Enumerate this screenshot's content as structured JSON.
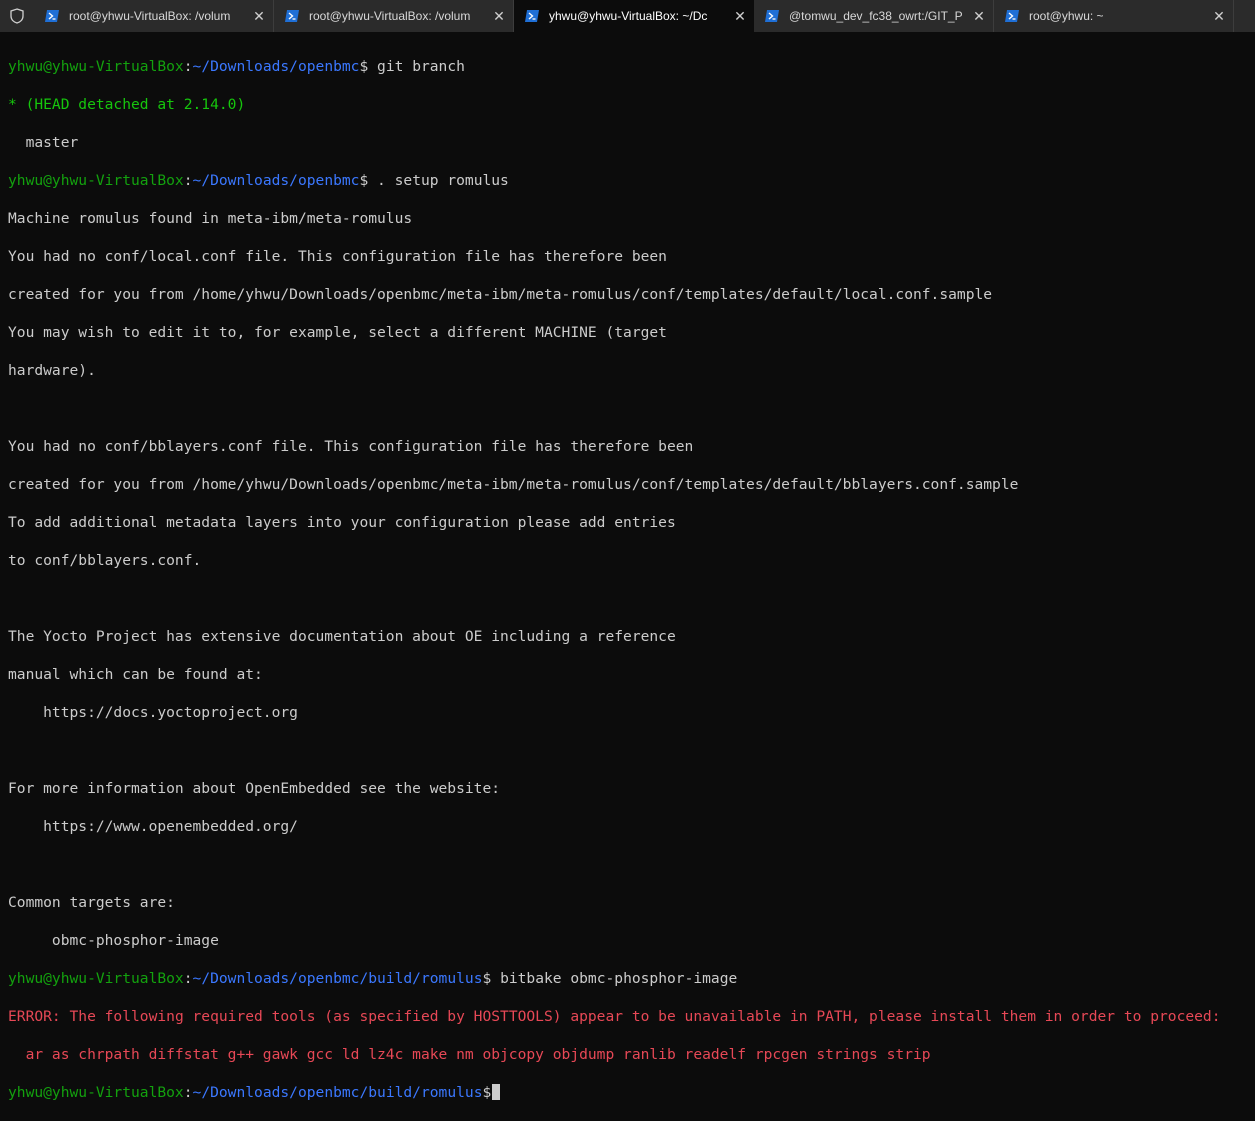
{
  "tabs": [
    {
      "label": "root@yhwu-VirtualBox: /volum",
      "icon": "powershell-icon",
      "active": false
    },
    {
      "label": "root@yhwu-VirtualBox: /volum",
      "icon": "powershell-icon",
      "active": false
    },
    {
      "label": "yhwu@yhwu-VirtualBox: ~/Dc",
      "icon": "powershell-icon",
      "active": true
    },
    {
      "label": "@tomwu_dev_fc38_owrt:/GIT_P",
      "icon": "powershell-icon",
      "active": false
    },
    {
      "label": "root@yhwu: ~",
      "icon": "powershell-icon",
      "active": false
    }
  ],
  "colors": {
    "user": "#13a10e",
    "path": "#3b78ff",
    "error": "#e74856",
    "branch": "#16c60c",
    "text": "#cccccc",
    "background": "#0c0c0c"
  },
  "terminal": {
    "prompt_user": "yhwu@yhwu-VirtualBox",
    "prompt_sep": ":",
    "prompt_end": "$",
    "path_repo": "~/Downloads/openbmc",
    "path_build": "~/Downloads/openbmc/build/romulus",
    "cmd1": " git branch",
    "branch_current": "* (HEAD detached at 2.14.0)",
    "branch_other": "  master",
    "cmd2": " . setup romulus",
    "out": [
      "Machine romulus found in meta-ibm/meta-romulus",
      "You had no conf/local.conf file. This configuration file has therefore been",
      "created for you from /home/yhwu/Downloads/openbmc/meta-ibm/meta-romulus/conf/templates/default/local.conf.sample",
      "You may wish to edit it to, for example, select a different MACHINE (target",
      "hardware).",
      "",
      "You had no conf/bblayers.conf file. This configuration file has therefore been",
      "created for you from /home/yhwu/Downloads/openbmc/meta-ibm/meta-romulus/conf/templates/default/bblayers.conf.sample",
      "To add additional metadata layers into your configuration please add entries",
      "to conf/bblayers.conf.",
      "",
      "The Yocto Project has extensive documentation about OE including a reference",
      "manual which can be found at:",
      "    https://docs.yoctoproject.org",
      "",
      "For more information about OpenEmbedded see the website:",
      "    https://www.openembedded.org/",
      "",
      "Common targets are:",
      "     obmc-phosphor-image"
    ],
    "cmd3": " bitbake obmc-phosphor-image",
    "error_prefix": "ERROR:",
    "error_msg": " The following required tools (as specified by HOSTTOOLS) appear to be unavailable in PATH, please install them in order to proceed:",
    "error_tools": "  ar as chrpath diffstat g++ gawk gcc ld lz4c make nm objcopy objdump ranlib readelf rpcgen strings strip"
  }
}
